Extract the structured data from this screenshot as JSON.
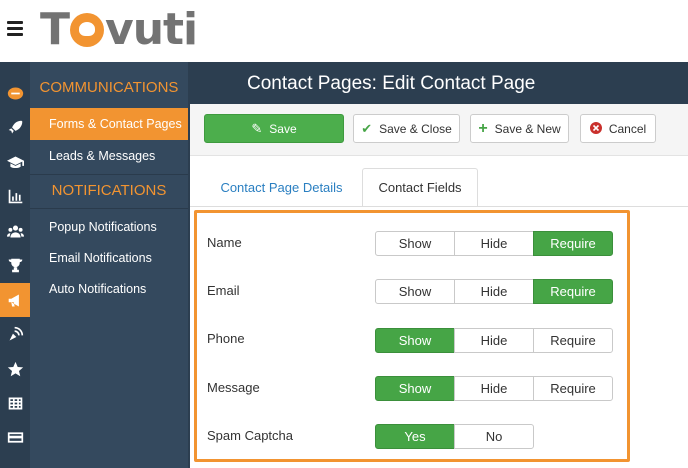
{
  "app": {
    "logo_text_left": "T",
    "logo_text_right": "vuti",
    "accent_color": "#f29431",
    "nav_bg": "#2c3e50",
    "success_color": "#46a546"
  },
  "rail": {
    "items": [
      {
        "icon": "chat-bubble-icon"
      },
      {
        "icon": "rocket-icon"
      },
      {
        "icon": "graduation-cap-icon"
      },
      {
        "icon": "bar-chart-icon"
      },
      {
        "icon": "users-icon"
      },
      {
        "icon": "trophy-icon"
      },
      {
        "icon": "megaphone-icon",
        "active": true
      },
      {
        "icon": "satellite-icon"
      },
      {
        "icon": "star-icon"
      },
      {
        "icon": "table-icon"
      },
      {
        "icon": "credit-card-icon"
      }
    ]
  },
  "submenu": {
    "communications_heading": "COMMUNICATIONS",
    "communications_items": [
      "Forms & Contact Pages",
      "Leads & Messages"
    ],
    "notifications_heading": "NOTIFICATIONS",
    "notifications_items": [
      "Popup Notifications",
      "Email Notifications",
      "Auto Notifications"
    ]
  },
  "header": {
    "title": "Contact Pages: Edit Contact Page"
  },
  "toolbar": {
    "save_label": "Save",
    "save_close_label": "Save & Close",
    "save_new_label": "Save & New",
    "cancel_label": "Cancel"
  },
  "tabs": {
    "details_label": "Contact Page Details",
    "fields_label": "Contact Fields",
    "active": "fields"
  },
  "fields": [
    {
      "label": "Name",
      "options": [
        "Show",
        "Hide",
        "Require"
      ],
      "selected": "Require"
    },
    {
      "label": "Email",
      "options": [
        "Show",
        "Hide",
        "Require"
      ],
      "selected": "Require"
    },
    {
      "label": "Phone",
      "options": [
        "Show",
        "Hide",
        "Require"
      ],
      "selected": "Show"
    },
    {
      "label": "Message",
      "options": [
        "Show",
        "Hide",
        "Require"
      ],
      "selected": "Show"
    },
    {
      "label": "Spam Captcha",
      "options": [
        "Yes",
        "No"
      ],
      "selected": "Yes"
    }
  ]
}
